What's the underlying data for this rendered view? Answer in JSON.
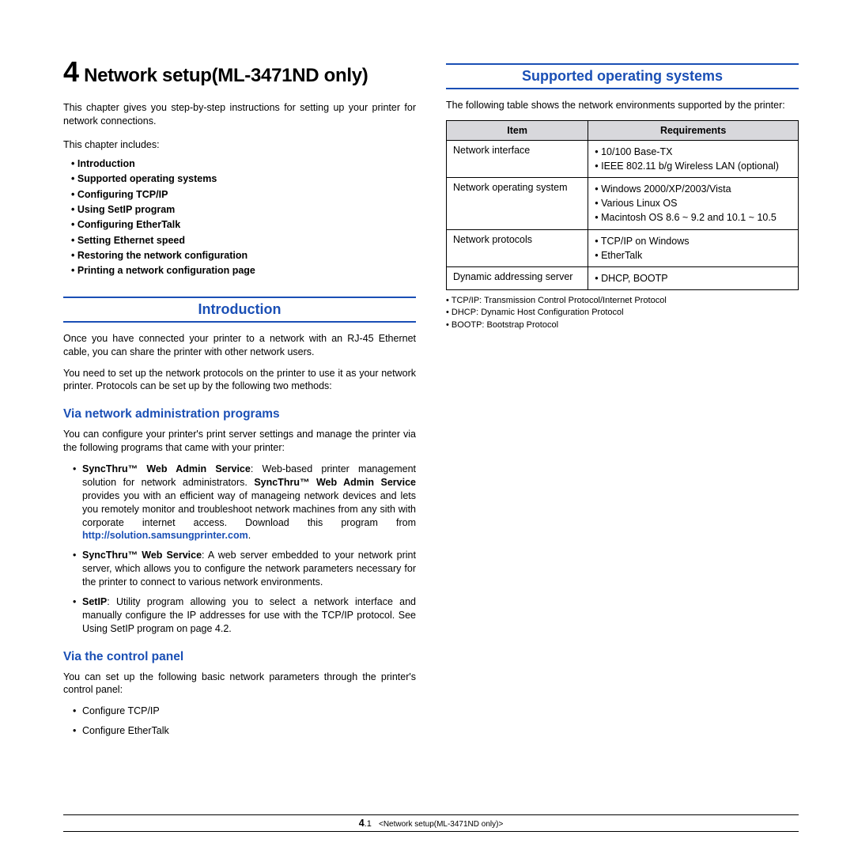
{
  "chapter": {
    "number": "4",
    "title": " Network setup(ML-3471ND only)"
  },
  "intro": "This chapter gives you step-by-step instructions for setting up your printer for network connections.",
  "includes_label": "This chapter includes:",
  "toc": [
    "Introduction",
    "Supported operating systems",
    "Configuring TCP/IP",
    "Using SetIP program",
    "Configuring EtherTalk",
    "Setting Ethernet speed",
    "Restoring the network configuration",
    "Printing a network configuration page"
  ],
  "s_intro": {
    "heading": "Introduction",
    "p1": "Once you have connected your printer to a network with an RJ-45 Ethernet cable, you can share the printer with other network users.",
    "p2": "You need to set up the network protocols on the printer to use it as your network printer. Protocols can be set up by the following two methods:"
  },
  "s_admin": {
    "heading": "Via network administration programs",
    "lead": "You can configure your printer's print server settings and manage the printer via the following programs that came with your printer:",
    "b1_a": "SyncThru™ Web Admin Service",
    "b1_b": ": Web-based printer management solution for network administrators. ",
    "b1_c": "SyncThru™ Web Admin Service",
    "b1_d": " provides you with an efficient way of manageing network devices and lets you remotely monitor and troubleshoot network machines from any sith with corporate internet access. Download this program from ",
    "b1_link": "http://solution.samsungprinter.com",
    "b1_e": ".",
    "b2_a": "SyncThru™ Web Service",
    "b2_b": ": A web server embedded to your network print server, which allows you to configure the network parameters necessary for the printer to connect to various network environments.",
    "b3_a": "SetIP",
    "b3_b": ": Utility program allowing you to select a network interface and manually configure the IP addresses for use with the TCP/IP protocol. See Using SetIP program on page 4.2."
  },
  "s_ctrl": {
    "heading": "Via the control panel",
    "lead": "You can set up the following basic network parameters through the printer's control panel:",
    "items": [
      "Configure TCP/IP",
      "Configure EtherTalk"
    ]
  },
  "s_os": {
    "heading": "Supported operating systems",
    "lead": "The following table shows the network environments supported by the printer:",
    "table_headers": {
      "item": "Item",
      "req": "Requirements"
    },
    "rows": [
      {
        "item": "Network interface",
        "reqs": [
          "10/100 Base-TX",
          "IEEE 802.11 b/g Wireless LAN (optional)"
        ]
      },
      {
        "item": "Network operating system",
        "reqs": [
          "Windows 2000/XP/2003/Vista",
          "Various Linux OS",
          "Macintosh OS 8.6 ~ 9.2 and 10.1 ~ 10.5"
        ]
      },
      {
        "item": "Network protocols",
        "reqs": [
          "TCP/IP on Windows",
          "EtherTalk"
        ]
      },
      {
        "item": "Dynamic addressing server",
        "reqs": [
          "DHCP, BOOTP"
        ]
      }
    ],
    "notes": [
      "TCP/IP: Transmission Control Protocol/Internet Protocol",
      "DHCP: Dynamic Host Configuration Protocol",
      "BOOTP: Bootstrap Protocol"
    ]
  },
  "footer": {
    "page_prefix": "4",
    "page_suffix": ".1",
    "title": "<Network setup(ML-3471ND only)>"
  }
}
